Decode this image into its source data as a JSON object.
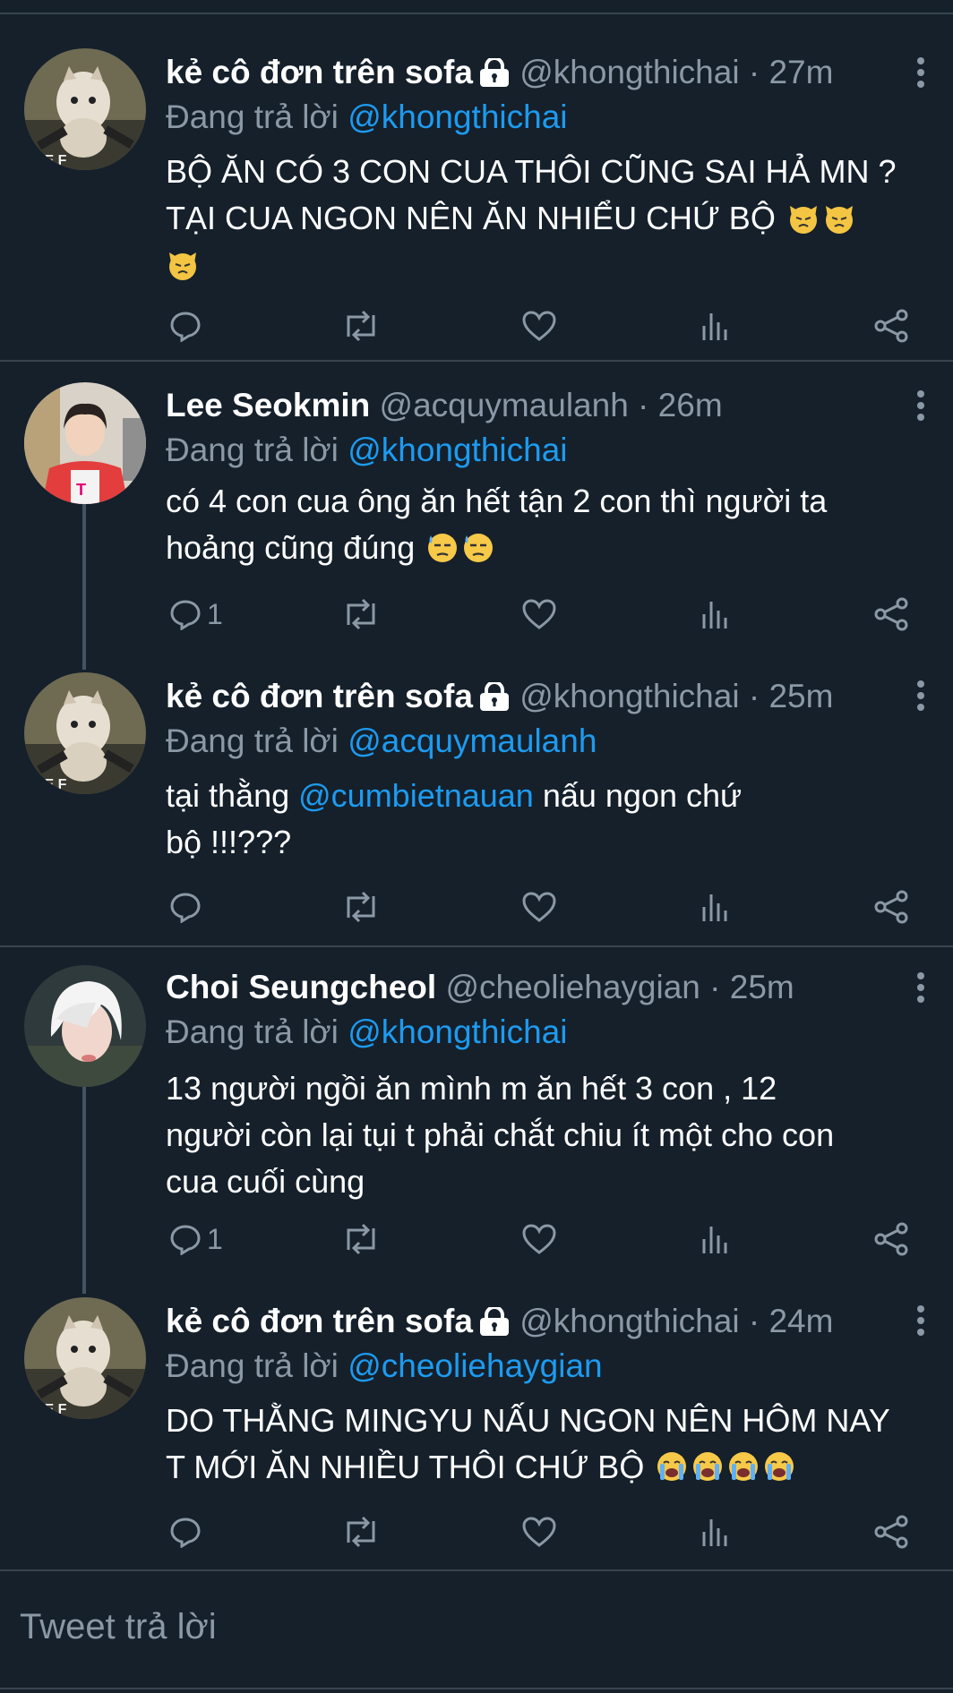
{
  "reply_prefix": "Đang trả lời",
  "tweets": [
    {
      "name": "kẻ cô đơn trên sofa",
      "locked": true,
      "handle": "@khongthichai",
      "time": "27m",
      "reply_to": "@khongthichai",
      "text_lines": [
        "BỘ ĂN CÓ 3 CON CUA THÔI CŨNG SAI HẢ MN ?",
        "TẠI CUA NGON NÊN ĂN NHIỂU CHỨ BỘ"
      ],
      "reply_count": ""
    },
    {
      "name": "Lee Seokmin",
      "locked": false,
      "handle": "@acquymaulanh",
      "time": "26m",
      "reply_to": "@khongthichai",
      "text_lines": [
        "có 4 con cua ông ăn hết tận 2 con thì người ta",
        "hoảng cũng đúng"
      ],
      "reply_count": "1"
    },
    {
      "name": "kẻ cô đơn trên sofa",
      "locked": true,
      "handle": "@khongthichai",
      "time": "25m",
      "reply_to": "@acquymaulanh",
      "text_prefix": "tại thằng ",
      "text_mention": "@cumbietnauan",
      "text_suffix": " nấu ngon chứ",
      "text_line2": "bộ !!!???",
      "reply_count": ""
    },
    {
      "name": "Choi Seungcheol",
      "locked": false,
      "handle": "@cheoliehaygian",
      "time": "25m",
      "reply_to": "@khongthichai",
      "text_lines": [
        "13 người ngồi ăn mình m ăn hết 3 con , 12",
        "người còn lại tụi t phải chắt chiu ít một cho con",
        "cua cuối cùng"
      ],
      "reply_count": "1"
    },
    {
      "name": "kẻ cô đơn trên sofa",
      "locked": true,
      "handle": "@khongthichai",
      "time": "24m",
      "reply_to": "@cheoliehaygian",
      "text_lines": [
        "DO THẰNG MINGYU NẤU NGON NÊN HÔM NAY",
        "T MỚI ĂN NHIỀU THÔI CHỨ BỘ"
      ],
      "reply_count": ""
    }
  ],
  "compose": {
    "placeholder": "Tweet trả lời"
  },
  "colors": {
    "background": "#15202b",
    "link": "#1d9bf0",
    "muted": "#8b98a5",
    "divider": "#38444d"
  },
  "icons": [
    "reply-icon",
    "retweet-icon",
    "like-icon",
    "analytics-icon",
    "share-icon",
    "more-icon",
    "lock-icon"
  ]
}
